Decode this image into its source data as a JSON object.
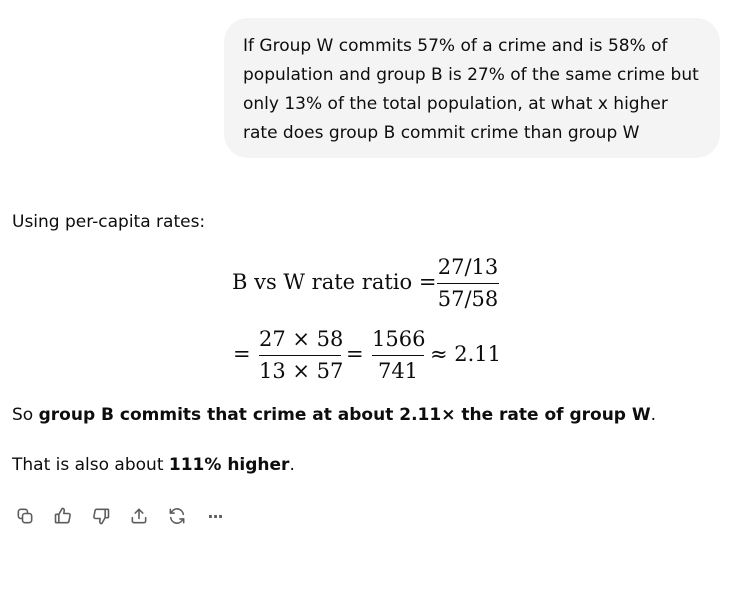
{
  "user_message": "If Group W commits 57% of a crime and is 58% of population and group B is 27% of the same crime but only 13% of the total population, at what x higher rate does group B commit crime than group W",
  "assistant": {
    "intro": "Using per-capita rates:",
    "equation1": {
      "lhs": "B vs W rate ratio =",
      "numerator": "27/13",
      "denominator": "57/58"
    },
    "equation2": {
      "eq1": "=",
      "frac1_num": "27 × 58",
      "frac1_den": "13 × 57",
      "eq2": "=",
      "frac2_num": "1566",
      "frac2_den": "741",
      "approx": "≈ 2.11"
    },
    "conclusion": {
      "prefix": "So ",
      "bold": "group B commits that crime at about 2.11× the rate of group W",
      "suffix": "."
    },
    "note": {
      "prefix": "That is also about ",
      "bold": "111% higher",
      "suffix": "."
    }
  },
  "actions": {
    "icons": [
      "copy-icon",
      "thumbs-up-icon",
      "thumbs-down-icon",
      "share-icon",
      "regenerate-icon",
      "more-icon"
    ],
    "more_label": "···"
  }
}
